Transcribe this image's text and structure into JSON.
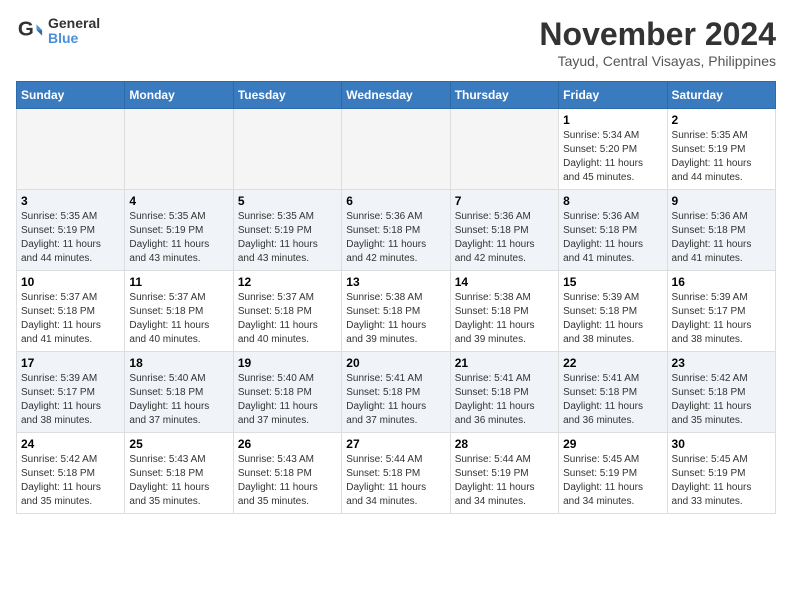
{
  "header": {
    "logo_line1": "General",
    "logo_line2": "Blue",
    "month_title": "November 2024",
    "subtitle": "Tayud, Central Visayas, Philippines"
  },
  "days_of_week": [
    "Sunday",
    "Monday",
    "Tuesday",
    "Wednesday",
    "Thursday",
    "Friday",
    "Saturday"
  ],
  "weeks": [
    [
      {
        "day": "",
        "info": ""
      },
      {
        "day": "",
        "info": ""
      },
      {
        "day": "",
        "info": ""
      },
      {
        "day": "",
        "info": ""
      },
      {
        "day": "",
        "info": ""
      },
      {
        "day": "1",
        "info": "Sunrise: 5:34 AM\nSunset: 5:20 PM\nDaylight: 11 hours\nand 45 minutes."
      },
      {
        "day": "2",
        "info": "Sunrise: 5:35 AM\nSunset: 5:19 PM\nDaylight: 11 hours\nand 44 minutes."
      }
    ],
    [
      {
        "day": "3",
        "info": "Sunrise: 5:35 AM\nSunset: 5:19 PM\nDaylight: 11 hours\nand 44 minutes."
      },
      {
        "day": "4",
        "info": "Sunrise: 5:35 AM\nSunset: 5:19 PM\nDaylight: 11 hours\nand 43 minutes."
      },
      {
        "day": "5",
        "info": "Sunrise: 5:35 AM\nSunset: 5:19 PM\nDaylight: 11 hours\nand 43 minutes."
      },
      {
        "day": "6",
        "info": "Sunrise: 5:36 AM\nSunset: 5:18 PM\nDaylight: 11 hours\nand 42 minutes."
      },
      {
        "day": "7",
        "info": "Sunrise: 5:36 AM\nSunset: 5:18 PM\nDaylight: 11 hours\nand 42 minutes."
      },
      {
        "day": "8",
        "info": "Sunrise: 5:36 AM\nSunset: 5:18 PM\nDaylight: 11 hours\nand 41 minutes."
      },
      {
        "day": "9",
        "info": "Sunrise: 5:36 AM\nSunset: 5:18 PM\nDaylight: 11 hours\nand 41 minutes."
      }
    ],
    [
      {
        "day": "10",
        "info": "Sunrise: 5:37 AM\nSunset: 5:18 PM\nDaylight: 11 hours\nand 41 minutes."
      },
      {
        "day": "11",
        "info": "Sunrise: 5:37 AM\nSunset: 5:18 PM\nDaylight: 11 hours\nand 40 minutes."
      },
      {
        "day": "12",
        "info": "Sunrise: 5:37 AM\nSunset: 5:18 PM\nDaylight: 11 hours\nand 40 minutes."
      },
      {
        "day": "13",
        "info": "Sunrise: 5:38 AM\nSunset: 5:18 PM\nDaylight: 11 hours\nand 39 minutes."
      },
      {
        "day": "14",
        "info": "Sunrise: 5:38 AM\nSunset: 5:18 PM\nDaylight: 11 hours\nand 39 minutes."
      },
      {
        "day": "15",
        "info": "Sunrise: 5:39 AM\nSunset: 5:18 PM\nDaylight: 11 hours\nand 38 minutes."
      },
      {
        "day": "16",
        "info": "Sunrise: 5:39 AM\nSunset: 5:17 PM\nDaylight: 11 hours\nand 38 minutes."
      }
    ],
    [
      {
        "day": "17",
        "info": "Sunrise: 5:39 AM\nSunset: 5:17 PM\nDaylight: 11 hours\nand 38 minutes."
      },
      {
        "day": "18",
        "info": "Sunrise: 5:40 AM\nSunset: 5:18 PM\nDaylight: 11 hours\nand 37 minutes."
      },
      {
        "day": "19",
        "info": "Sunrise: 5:40 AM\nSunset: 5:18 PM\nDaylight: 11 hours\nand 37 minutes."
      },
      {
        "day": "20",
        "info": "Sunrise: 5:41 AM\nSunset: 5:18 PM\nDaylight: 11 hours\nand 37 minutes."
      },
      {
        "day": "21",
        "info": "Sunrise: 5:41 AM\nSunset: 5:18 PM\nDaylight: 11 hours\nand 36 minutes."
      },
      {
        "day": "22",
        "info": "Sunrise: 5:41 AM\nSunset: 5:18 PM\nDaylight: 11 hours\nand 36 minutes."
      },
      {
        "day": "23",
        "info": "Sunrise: 5:42 AM\nSunset: 5:18 PM\nDaylight: 11 hours\nand 35 minutes."
      }
    ],
    [
      {
        "day": "24",
        "info": "Sunrise: 5:42 AM\nSunset: 5:18 PM\nDaylight: 11 hours\nand 35 minutes."
      },
      {
        "day": "25",
        "info": "Sunrise: 5:43 AM\nSunset: 5:18 PM\nDaylight: 11 hours\nand 35 minutes."
      },
      {
        "day": "26",
        "info": "Sunrise: 5:43 AM\nSunset: 5:18 PM\nDaylight: 11 hours\nand 35 minutes."
      },
      {
        "day": "27",
        "info": "Sunrise: 5:44 AM\nSunset: 5:18 PM\nDaylight: 11 hours\nand 34 minutes."
      },
      {
        "day": "28",
        "info": "Sunrise: 5:44 AM\nSunset: 5:19 PM\nDaylight: 11 hours\nand 34 minutes."
      },
      {
        "day": "29",
        "info": "Sunrise: 5:45 AM\nSunset: 5:19 PM\nDaylight: 11 hours\nand 34 minutes."
      },
      {
        "day": "30",
        "info": "Sunrise: 5:45 AM\nSunset: 5:19 PM\nDaylight: 11 hours\nand 33 minutes."
      }
    ]
  ]
}
